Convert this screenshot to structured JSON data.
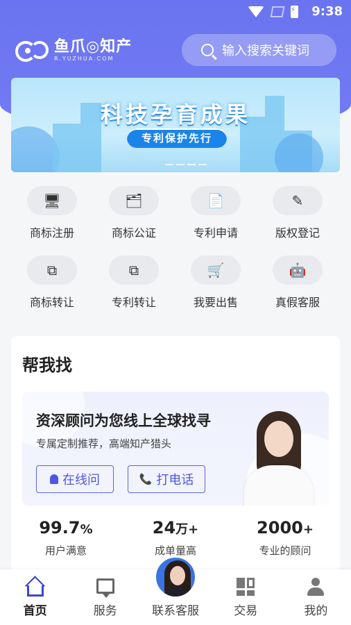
{
  "status_bar": {
    "time": "9:38"
  },
  "header": {
    "logo_name": "鱼爪◎知产",
    "logo_domain": "R.YUZHUA.COM",
    "search_placeholder": "输入搜索关键词"
  },
  "banner": {
    "title": "科技孕育成果",
    "subtitle": "专利保护先行"
  },
  "services": [
    {
      "label": "商标注册",
      "icon": "monitor-icon",
      "glyph": "🖥"
    },
    {
      "label": "商标公证",
      "icon": "certificate-icon",
      "glyph": "🗂"
    },
    {
      "label": "专利申请",
      "icon": "patent-doc-icon",
      "glyph": "📄"
    },
    {
      "label": "版权登记",
      "icon": "pen-icon",
      "glyph": "✎"
    },
    {
      "label": "商标转让",
      "icon": "transfer-icon",
      "glyph": "⧉"
    },
    {
      "label": "专利转让",
      "icon": "patent-transfer-icon",
      "glyph": "⧉"
    },
    {
      "label": "我要出售",
      "icon": "cart-icon",
      "glyph": "🛒"
    },
    {
      "label": "真假客服",
      "icon": "service-bot-icon",
      "glyph": "🤖"
    }
  ],
  "help_section": {
    "title": "帮我找",
    "headline": "资深顾问为您线上全球找寻",
    "subline": "专属定制推荐，高端知产猎头",
    "btn_online": "在线问",
    "btn_call": "打电话"
  },
  "stats": [
    {
      "value": "99.7",
      "unit": "%",
      "caption": "用户满意"
    },
    {
      "value": "24",
      "unit": "万+",
      "caption": "成单量高"
    },
    {
      "value": "2000",
      "unit": "+",
      "caption": "专业的顾问"
    }
  ],
  "tabbar": {
    "home": "首页",
    "service": "服务",
    "contact": "联系客服",
    "trade": "交易",
    "me": "我的"
  },
  "colors": {
    "brand": "#6b74f0",
    "accent": "#4f58e4"
  }
}
